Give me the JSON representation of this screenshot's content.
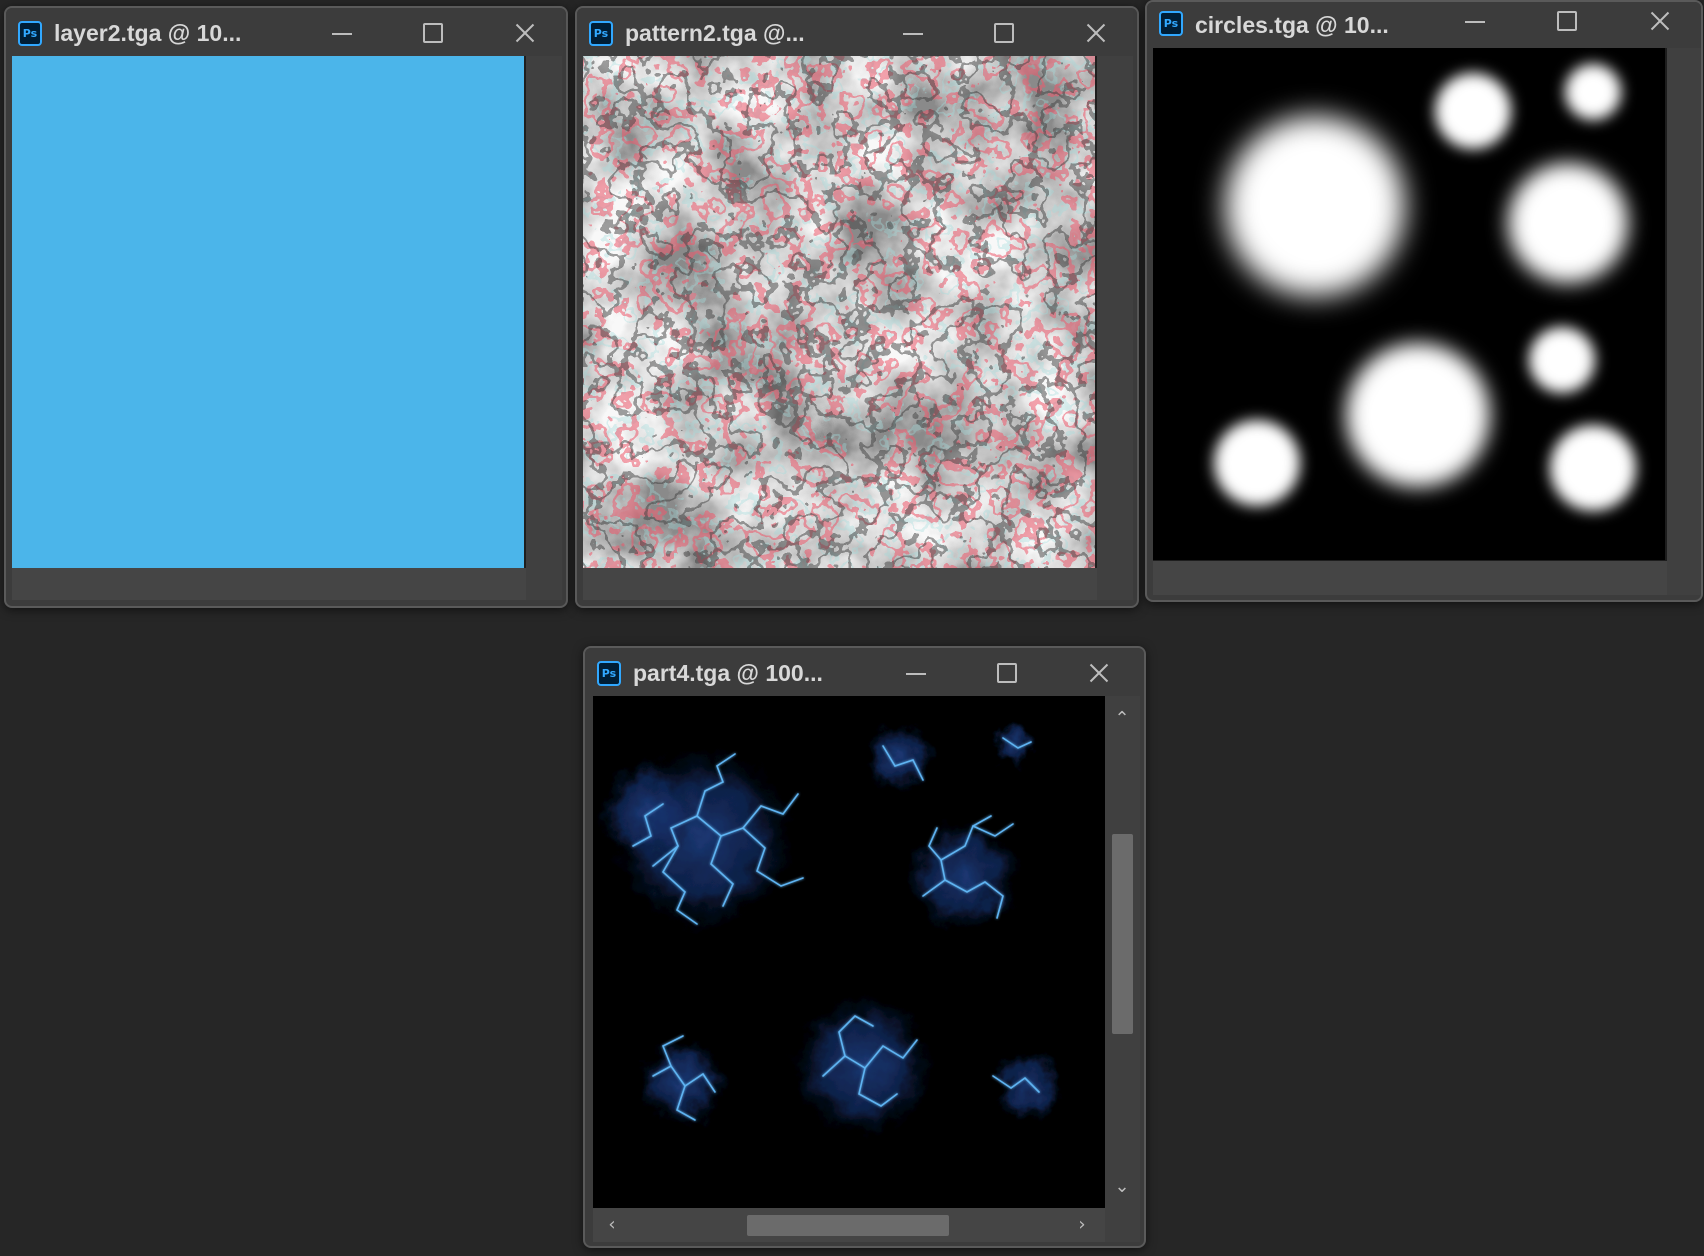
{
  "app": {
    "icon_label": "Ps"
  },
  "windows": [
    {
      "title": "layer2.tga @ 10...",
      "image": "solid sky-blue fill"
    },
    {
      "title": "pattern2.tga @...",
      "image": "grey cloud texture with red and black edge contours"
    },
    {
      "title": "circles.tga @ 10...",
      "image": "soft white circles on black"
    },
    {
      "title": "part4.tga @ 100...",
      "image": "blue electric nebula clusters on black"
    }
  ],
  "scrollbars": {
    "up_arrow": "⌃",
    "down_arrow": "⌄",
    "left_arrow": "‹",
    "right_arrow": "›"
  },
  "colors": {
    "desktop": "#262626",
    "window_frame": "#3c3c3c",
    "accent_ps": "#31a8ff",
    "layer2_fill": "#4bb5ea"
  }
}
